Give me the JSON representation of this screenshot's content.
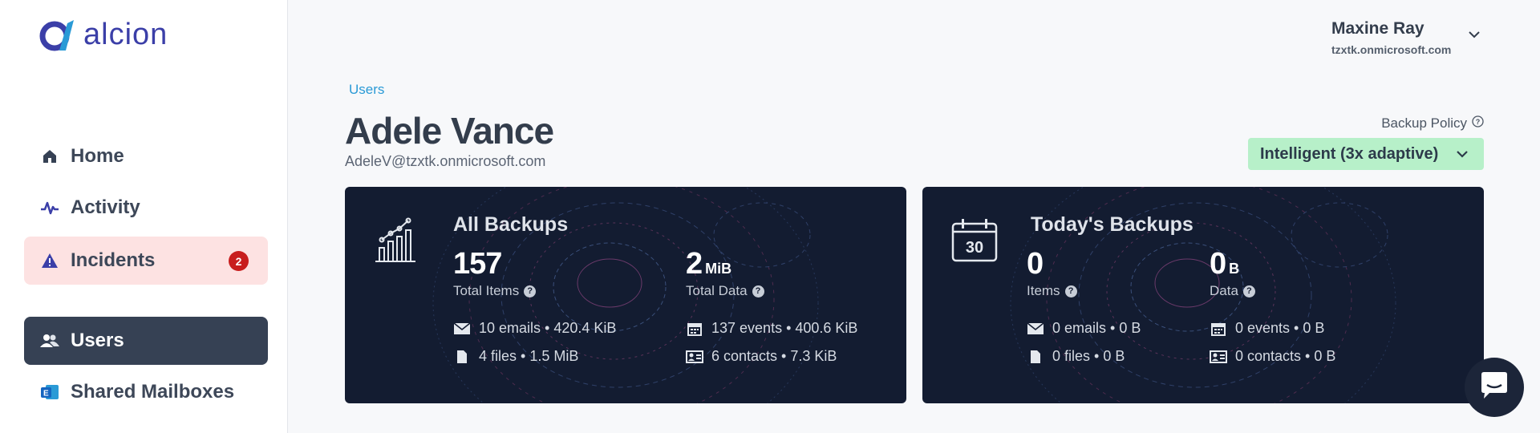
{
  "brand": {
    "name": "alcion"
  },
  "sidebar": {
    "items": [
      {
        "label": "Home",
        "icon": "home-icon"
      },
      {
        "label": "Activity",
        "icon": "activity-icon"
      },
      {
        "label": "Incidents",
        "icon": "warning-icon",
        "badge": "2"
      },
      {
        "label": "Users",
        "icon": "users-icon"
      },
      {
        "label": "Shared Mailboxes",
        "icon": "exchange-icon"
      }
    ]
  },
  "header": {
    "user_name": "Maxine Ray",
    "tenant": "tzxtk.onmicrosoft.com"
  },
  "breadcrumb": "Users",
  "page": {
    "title": "Adele Vance",
    "email": "AdeleV@tzxtk.onmicrosoft.com"
  },
  "policy": {
    "label": "Backup Policy",
    "value": "Intelligent (3x adaptive)"
  },
  "cards": {
    "all": {
      "title": "All Backups",
      "items_value": "157",
      "items_label": "Total Items",
      "data_value": "2",
      "data_unit": "MiB",
      "data_label": "Total Data",
      "emails": "10 emails • 420.4 KiB",
      "files": "4 files • 1.5 MiB",
      "events": "137 events • 400.6 KiB",
      "contacts": "6 contacts • 7.3 KiB"
    },
    "today": {
      "title": "Today's Backups",
      "calendar_day": "30",
      "items_value": "0",
      "items_label": "Items",
      "data_value": "0",
      "data_unit": "B",
      "data_label": "Data",
      "emails": "0 emails • 0 B",
      "files": "0 files • 0 B",
      "events": "0 events • 0 B",
      "contacts": "0 contacts • 0 B"
    }
  },
  "colors": {
    "accent_blue": "#2a9ad6",
    "card_bg": "#131c31",
    "policy_bg": "#b7f0c9",
    "nav_active": "#364154",
    "incident_bg": "#fde2e2",
    "badge_red": "#c81e1e"
  }
}
